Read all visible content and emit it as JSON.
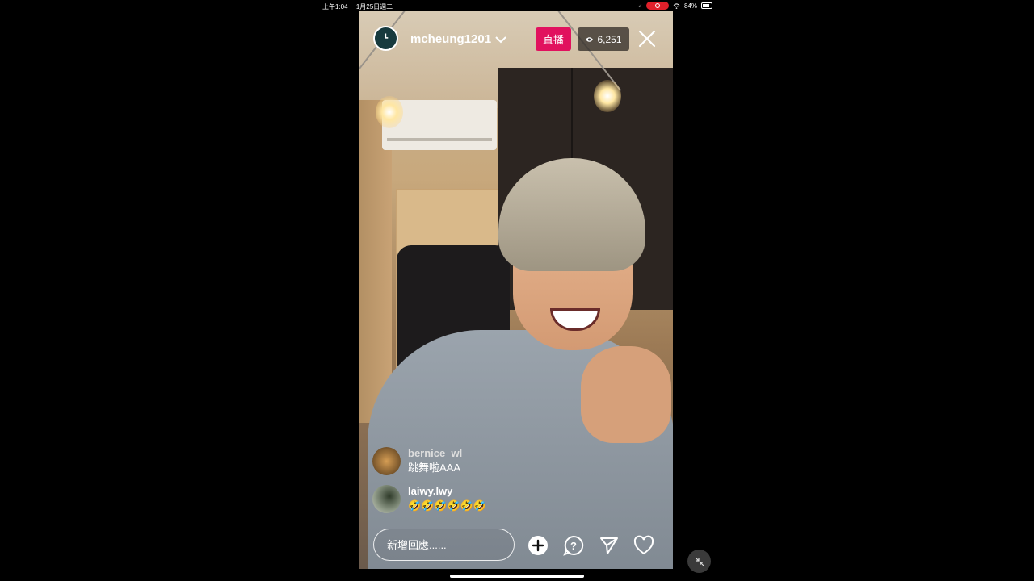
{
  "status_bar": {
    "time": "上午1:04",
    "date": "1月25日週二",
    "battery": "84%"
  },
  "stream": {
    "username": "mcheung1201",
    "live_label": "直播",
    "viewer_count": "6,251"
  },
  "comments": [
    {
      "username": "bernice_wl",
      "text": "跳舞啦AAA"
    },
    {
      "username": "laiwy.lwy",
      "text": "🤣🤣🤣🤣🤣🤣"
    }
  ],
  "reply": {
    "placeholder": "新增回應......"
  },
  "icons": {
    "add": "plus-circle-icon",
    "question": "question-icon",
    "share": "send-icon",
    "like": "heart-icon",
    "close": "close-icon",
    "views": "eye-icon",
    "shrink": "minimize-icon"
  },
  "colors": {
    "live_badge": "#e1115e",
    "record_indicator": "#e0202a"
  }
}
